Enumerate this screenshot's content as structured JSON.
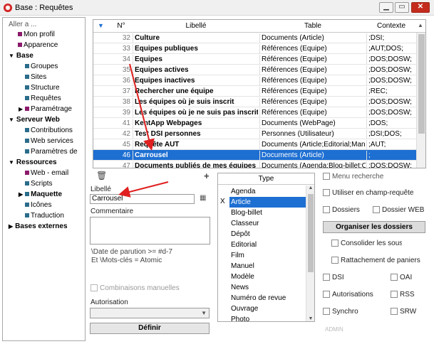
{
  "window": {
    "title": "Base : Requêtes"
  },
  "sidebar": {
    "search_placeholder": "Aller a ...",
    "items": [
      {
        "label": "Mon profil"
      },
      {
        "label": "Apparence"
      },
      {
        "label": "Base"
      },
      {
        "label": "Groupes"
      },
      {
        "label": "Sites"
      },
      {
        "label": "Structure"
      },
      {
        "label": "Requêtes"
      },
      {
        "label": "Paramétrage"
      },
      {
        "label": "Serveur Web"
      },
      {
        "label": "Contributions"
      },
      {
        "label": "Web services"
      },
      {
        "label": "Paramètres de"
      },
      {
        "label": "Ressources"
      },
      {
        "label": "Web - email"
      },
      {
        "label": "Scripts"
      },
      {
        "label": "Maquette"
      },
      {
        "label": "Icônes"
      },
      {
        "label": "Traduction"
      },
      {
        "label": "Bases externes"
      }
    ]
  },
  "table": {
    "headers": {
      "num": "N°",
      "libelle": "Libellé",
      "table": "Table",
      "contexte": "Contexte"
    },
    "rows": [
      {
        "num": "32",
        "libelle": "Culture",
        "table": "Documents (Article)",
        "contexte": ";DSI;"
      },
      {
        "num": "33",
        "libelle": "Equipes publiques",
        "table": "Références (Equipe)",
        "contexte": ";AUT;DOS;"
      },
      {
        "num": "34",
        "libelle": "Equipes",
        "table": "Références (Equipe)",
        "contexte": ";DOS;DOSW;"
      },
      {
        "num": "35",
        "libelle": "Equipes actives",
        "table": "Références (Equipe)",
        "contexte": ";DOS;DOSW;"
      },
      {
        "num": "36",
        "libelle": "Equipes inactives",
        "table": "Références (Equipe)",
        "contexte": ";DOS;DOSW;"
      },
      {
        "num": "37",
        "libelle": "Rechercher une équipe",
        "table": "Références (Equipe)",
        "contexte": ";REC;"
      },
      {
        "num": "38",
        "libelle": "Les équipes où je suis inscrit",
        "table": "Références (Equipe)",
        "contexte": ";DOS;DOSW;"
      },
      {
        "num": "39",
        "libelle": "Les équipes où je ne suis pas inscrit",
        "table": "Références (Equipe)",
        "contexte": ";DOS;DOSW;"
      },
      {
        "num": "41",
        "libelle": "KentApp Webpages",
        "table": "Documents (WebPage)",
        "contexte": ";DOS;"
      },
      {
        "num": "42",
        "libelle": "Test DSI personnes",
        "table": "Personnes (Utilisateur)",
        "contexte": ";DSI;DOS;"
      },
      {
        "num": "45",
        "libelle": "Requête AUT",
        "table": "Documents (Article;Editorial;Manu...",
        "contexte": ";AUT;"
      },
      {
        "num": "46",
        "libelle": "Carrousel",
        "table": "Documents (Article)",
        "contexte": ";"
      },
      {
        "num": "47",
        "libelle": "Documents publiés de mes équipes",
        "table": "Documents (Agenda;Blog-billet;Cl...",
        "contexte": ";DOS;DOSW;"
      }
    ]
  },
  "form": {
    "libelle_label": "Libellé",
    "libelle_value": "Carrousel",
    "commentaire_label": "Commentaire",
    "commentaire_value": "",
    "query_text_1": "\\Date de parution >= #d-7",
    "query_text_2": "Et \\Mots-clés = Atomic",
    "combinaisons_label": "Combinaisons manuelles",
    "autorisation_label": "Autorisation",
    "autorisation_value": "",
    "definir_label": "Définir"
  },
  "types": {
    "header": "Type",
    "selected_mark": "X",
    "items": [
      "Agenda",
      "Article",
      "Blog-billet",
      "Classeur",
      "Dépôt",
      "Editorial",
      "Film",
      "Manuel",
      "Modèle",
      "News",
      "Numéro de revue",
      "Ouvrage",
      "Photo"
    ]
  },
  "options": {
    "menu_recherche": "Menu recherche",
    "utiliser_champ": "Utiliser en champ-requête",
    "dossiers": "Dossiers",
    "dossier_web": "Dossier WEB",
    "organiser": "Organiser les dossiers",
    "consolider": "Consolider les sous dossiers",
    "rattachement": "Rattachement de paniers",
    "dsi": "DSI",
    "oai": "OAI",
    "autorisations": "Autorisations",
    "rss": "RSS",
    "synchro": "Synchro",
    "srw": "SRW",
    "admin": "ADMIN"
  },
  "colors": {
    "selection": "#1e6fd2",
    "annotation_arrow": "#e02020"
  }
}
